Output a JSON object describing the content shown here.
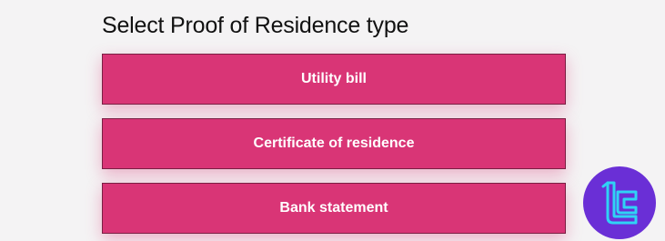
{
  "page": {
    "title": "Select Proof of Residence type"
  },
  "options": [
    {
      "label": "Utility bill"
    },
    {
      "label": "Certificate of residence"
    },
    {
      "label": "Bank statement"
    }
  ],
  "colors": {
    "background": "#f4f3f4",
    "button_fill": "#d93576",
    "button_border": "#7a1f43",
    "button_text": "#ffffff",
    "logo_background": "#6a2fd6",
    "logo_mark": "#2fd3f5"
  },
  "logo": {
    "icon": "brand-logo-icon"
  }
}
